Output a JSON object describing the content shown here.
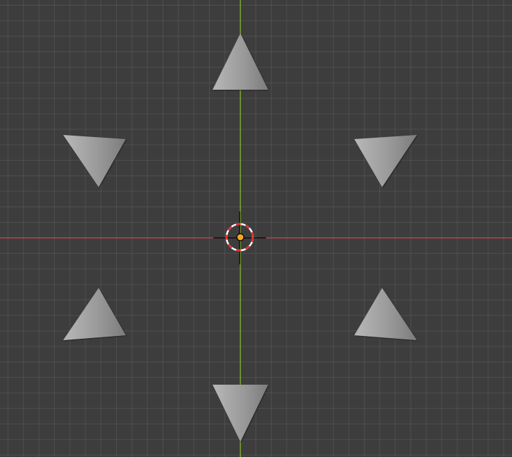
{
  "viewport": {
    "view": "top-orthographic",
    "background_color": "#3d3d3d",
    "grid_line_color": "#4a4a4a"
  },
  "axes": {
    "x_axis_color": "#c8484f",
    "y_axis_color": "#8bbd2f"
  },
  "objects": [
    {
      "kind": "cone",
      "icon": "cone-icon",
      "direction": "up"
    },
    {
      "kind": "cone",
      "icon": "cone-icon",
      "direction": "down-right"
    },
    {
      "kind": "cone",
      "icon": "cone-icon",
      "direction": "down-left"
    },
    {
      "kind": "cone",
      "icon": "cone-icon",
      "direction": "up-right"
    },
    {
      "kind": "cone",
      "icon": "cone-icon",
      "direction": "up-left"
    },
    {
      "kind": "cone",
      "icon": "cone-icon",
      "direction": "down"
    }
  ],
  "cursor_3d": {
    "icon": "3d-cursor-icon",
    "ring_colors": [
      "#e03030",
      "#ffffff"
    ]
  },
  "object_origin": {
    "icon": "origin-dot-icon",
    "color": "#f5a623"
  },
  "cone_shading": {
    "light": "#b8b8b8",
    "mid": "#9a9a9a",
    "dark": "#7c7c7c"
  }
}
